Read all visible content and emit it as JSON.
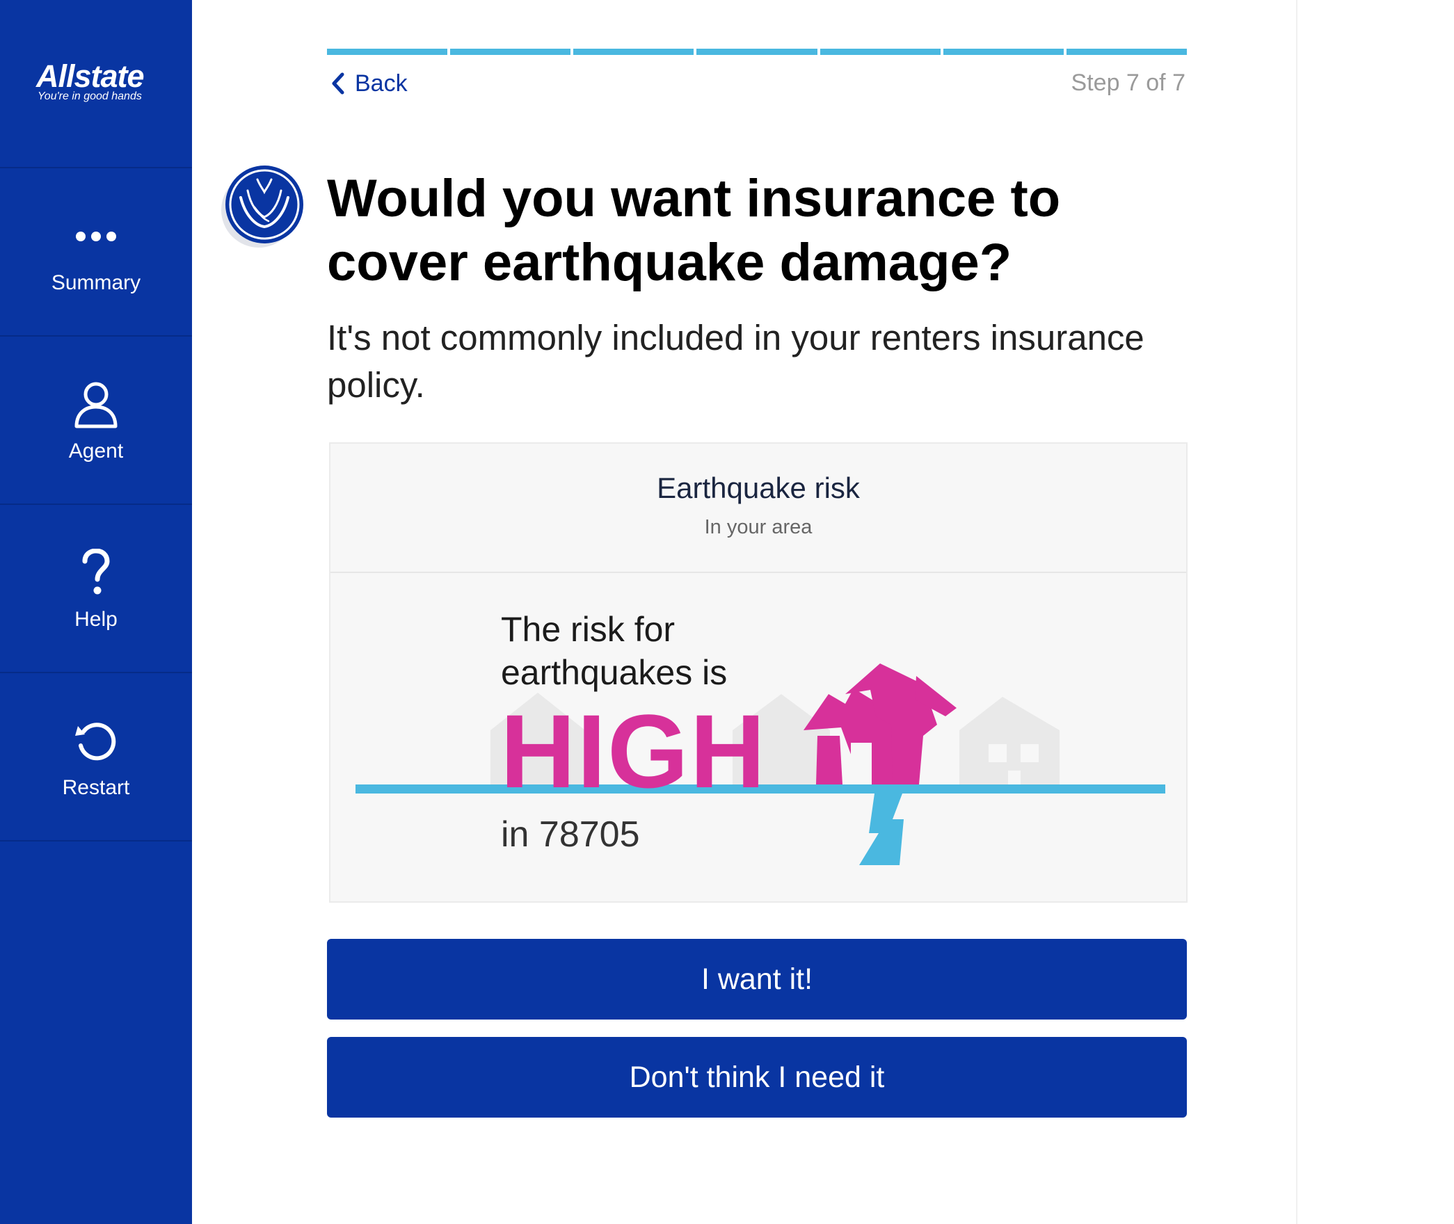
{
  "brand": {
    "name": "Allstate",
    "tagline": "You're in good hands"
  },
  "sidebar": {
    "items": [
      {
        "label": "Summary",
        "icon": "more-dots-icon"
      },
      {
        "label": "Agent",
        "icon": "person-icon"
      },
      {
        "label": "Help",
        "icon": "question-icon"
      },
      {
        "label": "Restart",
        "icon": "restart-icon"
      }
    ]
  },
  "progress": {
    "completed_steps": 7,
    "total_steps": 7
  },
  "nav": {
    "back_label": "Back",
    "step_text": "Step 7 of 7"
  },
  "question": {
    "title": "Would you want insurance to cover earthquake damage?",
    "subtitle": "It's not commonly included in your renters insurance policy."
  },
  "risk_card": {
    "title": "Earthquake risk",
    "subtitle": "In your area",
    "line1": "The risk for",
    "line2": "earthquakes is",
    "level": "HIGH",
    "zip_text": "in 78705"
  },
  "actions": {
    "want_label": "I want it!",
    "decline_label": "Don't think I need it"
  },
  "colors": {
    "sidebar": "#0935a2",
    "accent": "#4ab8e0",
    "risk_high": "#d7319a",
    "button": "#0935a2"
  }
}
